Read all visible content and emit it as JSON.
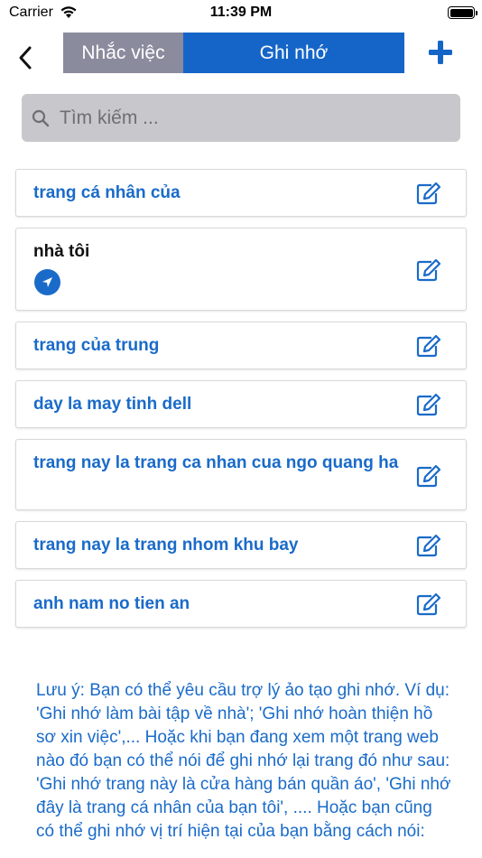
{
  "status_bar": {
    "carrier": "Carrier",
    "time": "11:39 PM"
  },
  "nav": {
    "tabs": [
      {
        "label": "Nhắc việc",
        "active": false
      },
      {
        "label": "Ghi nhớ",
        "active": true
      }
    ]
  },
  "search": {
    "placeholder": "Tìm kiếm ..."
  },
  "notes": [
    {
      "title": "trang cá nhân của"
    },
    {
      "title": "nhà tôi",
      "has_location": true
    },
    {
      "title": "trang của trung"
    },
    {
      "title": "day la may tinh dell"
    },
    {
      "title": "trang nay la trang ca nhan cua ngo quang ha"
    },
    {
      "title": "trang nay la trang nhom khu bay"
    },
    {
      "title": "anh nam no tien an"
    }
  ],
  "hint": "Lưu ý: Bạn có thể yêu cầu trợ lý ảo tạo ghi nhớ. Ví dụ: 'Ghi nhớ làm bài tập về nhà'; 'Ghi nhớ hoàn thiện hồ sơ xin việc',... Hoặc khi bạn đang xem một trang web nào đó bạn có thể nói để ghi nhớ lại trang đó như sau: 'Ghi nhớ trang này là cửa hàng bán quần áo', 'Ghi nhớ đây là trang cá nhân của bạn tôi', .... Hoặc bạn cũng có thể ghi nhớ vị trí hiện tại của bạn bằng cách nói:",
  "colors": {
    "accent": "#1565c8",
    "link": "#1a6bc9",
    "segment_inactive": "#8b8b9e",
    "search_bg": "#c7c7cc"
  }
}
